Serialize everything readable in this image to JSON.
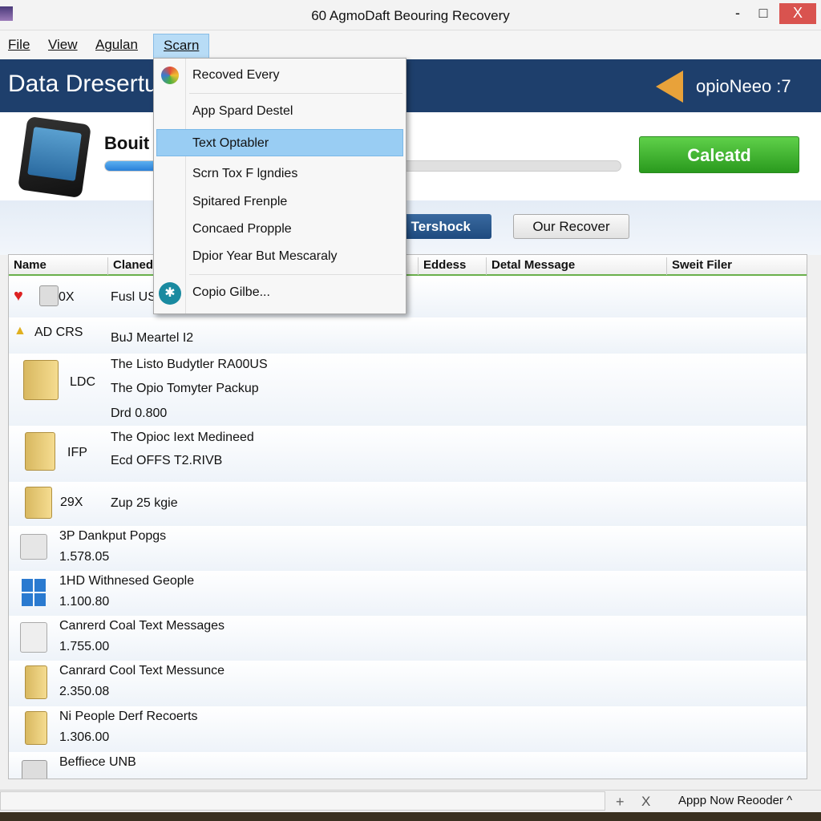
{
  "window": {
    "title": "60 AgmoDaft Beouring Recovery",
    "minimize": "-",
    "maximize": "□",
    "close": "X"
  },
  "menubar": [
    "File",
    "View",
    "Agulan",
    "Scarn"
  ],
  "banner": {
    "title": "Data Dresertu",
    "brand": "opioNeeo :7"
  },
  "device": {
    "name": "Bouit",
    "progress_percent": 10,
    "calc_button": "Caleatd"
  },
  "actions": {
    "tershock": "n Tershock",
    "recover": "Our Recover"
  },
  "table": {
    "headers": [
      "Name",
      "Claned",
      "Eddess",
      "Detal Message",
      "Sweit Filer"
    ],
    "rows": [
      {
        "name": "0X",
        "lines": [
          "Fusl US"
        ]
      },
      {
        "name": "AD CRS",
        "lines": [
          "BuJ Meartel I2"
        ]
      },
      {
        "name": "LDC",
        "lines": [
          "The Listo Budytler RA00US",
          "The Opio Tomyter Packup",
          "Drd 0.800"
        ]
      },
      {
        "name": "IFP",
        "lines": [
          "The Opioc Iext Medineed",
          "Ecd OFFS T2.RIVB"
        ]
      },
      {
        "name": "29X",
        "lines": [
          "Zup 25 kgie"
        ]
      }
    ],
    "items": [
      {
        "title": "3P Dankput Popgs",
        "value": "1.578.05"
      },
      {
        "title": "1HD Withnesed Geople",
        "value": "1.100.80"
      },
      {
        "title": "Canrerd Coal Text Messages",
        "value": "1.755.00"
      },
      {
        "title": "Canrard Cool Text Messunce",
        "value": "2.350.08"
      },
      {
        "title": "Ni People Derf Recoerts",
        "value": "1.306.00"
      },
      {
        "title": "Beffiece UNB",
        "value": ""
      }
    ]
  },
  "status": {
    "add": "+",
    "close": "X",
    "label": "Appp Now Reooder ^"
  },
  "dropdown": {
    "items": [
      "Recoved Every",
      "App Spard Destel",
      "Text Optabler",
      "Scrn Tox F lgndies",
      "Spitared Frenple",
      "Concaed Propple",
      "Dpior Year But Mescaraly",
      "Copio Gilbe..."
    ],
    "selected": "Text Optabler"
  },
  "colors": {
    "banner": "#1e3f6c",
    "accent_green": "#2a9a1e",
    "highlight": "#99cdf3"
  }
}
